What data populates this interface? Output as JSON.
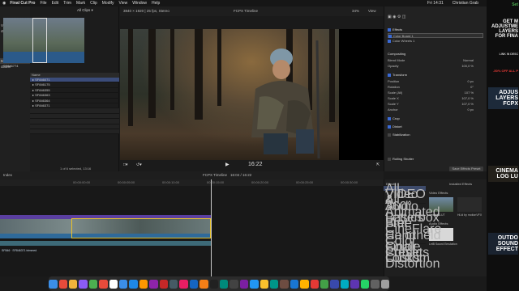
{
  "menubar": {
    "items": [
      "Final Cut Pro",
      "File",
      "Edit",
      "Trim",
      "Mark",
      "Clip",
      "Modify",
      "View",
      "Window",
      "Help"
    ],
    "right": [
      "Fri 14:31",
      "Christian Grab"
    ]
  },
  "library": {
    "items": [
      "Video",
      "ctions",
      "Middle",
      "ctions"
    ],
    "selected_index": 2
  },
  "browser": {
    "filter_label": "All Clips",
    "thumb_label": "SF846774",
    "list_header": "Name",
    "clips": [
      "SF846071",
      "SF846175",
      "SF846355",
      "SF846363",
      "SF846364",
      "SF846371"
    ],
    "selected_count": "1 of 6 selected, 13:16"
  },
  "viewer": {
    "format": "3840 × 1920 | 25 fps, Stereo",
    "title": "FCPX Timeline",
    "zoom": "34%",
    "view_label": "View",
    "timecode": "16:22"
  },
  "inspector": {
    "sections": {
      "effects": "Effects",
      "compositing": "Compositing",
      "transform": "Transform",
      "crop": "Crop",
      "distort": "Distort",
      "stabilization": "Stabilization",
      "rolling_shutter": "Rolling Shutter"
    },
    "effects": [
      "Color Board 1",
      "Color Wheels 1"
    ],
    "blend_mode": {
      "label": "Blend Mode",
      "value": "Normal"
    },
    "opacity": {
      "label": "Opacity",
      "value": "100,0 %"
    },
    "transform_rows": [
      {
        "label": "Position",
        "value": "0 px"
      },
      {
        "label": "Rotation",
        "value": "0°"
      },
      {
        "label": "Scale (All)",
        "value": "107 %"
      },
      {
        "label": "Scale X",
        "value": "107,0 %"
      },
      {
        "label": "Scale Y",
        "value": "107,0 %"
      },
      {
        "label": "Anchor",
        "value": "0 px"
      }
    ],
    "save_preset": "Save Effects Preset"
  },
  "timeline": {
    "index_label": "Index",
    "title": "FCPX Timeline",
    "duration": "16:04 / 16:22",
    "ruler": [
      "00:00:00:00",
      "00:00:05:00",
      "00:00:10:00",
      "00:00:15:00",
      "00:00:20:00",
      "00:00:25:00",
      "00:00:30:00"
    ],
    "audio_label": "SF846 · SF846371 trimmed"
  },
  "effects_browser": {
    "title": "Effects",
    "installed": "Installed Effects",
    "categories": [
      "All Video & Audio",
      "VIDEO",
      "All",
      "360°",
      "Animated Letterbox Free",
      "Basics",
      "Blur",
      "CineFlare Handheld",
      "Color",
      "Color Finale",
      "Color Presets",
      "Comic Looks",
      "Custom",
      "Distortion"
    ],
    "selected_index": 0,
    "group_video": "Video Effects",
    "group_audio": "Audio Effects",
    "items": [
      "Custom LUT",
      "Hi-ld by motionVFX",
      "LeiB Sound Emulation"
    ]
  },
  "dock": {
    "colors": [
      "#3b8ee8",
      "#e84b3b",
      "#f2b33b",
      "#8b5cf6",
      "#4caf50",
      "#e84b3b",
      "#ffffff",
      "#3b8ee8",
      "#1e88e5",
      "#ff9800",
      "#8e24aa",
      "#c62828",
      "#455a64",
      "#e91e63",
      "#1565c0",
      "#f57f17",
      "#212121",
      "#00897b",
      "#424242",
      "#7b1fa2",
      "#2196f3",
      "#fbc02d",
      "#009688",
      "#6d4c41",
      "#1976d2",
      "#ffb300",
      "#e53935",
      "#43a047",
      "#3949ab",
      "#00acc1",
      "#5e35b1",
      "#25d366",
      "#616161",
      "#9e9e9e"
    ]
  },
  "promo": {
    "line1": "GET M ADJUSTME LAYERS FOR FINA",
    "line1_link": "LINK IN DESC",
    "line2": "-50% OFF ALL P",
    "line3": "ADJUS LAYERS FCPX",
    "line4": "CINEMA LOG LU",
    "line5": "OUTDO SOUND EFFECT",
    "brand": "Set"
  }
}
